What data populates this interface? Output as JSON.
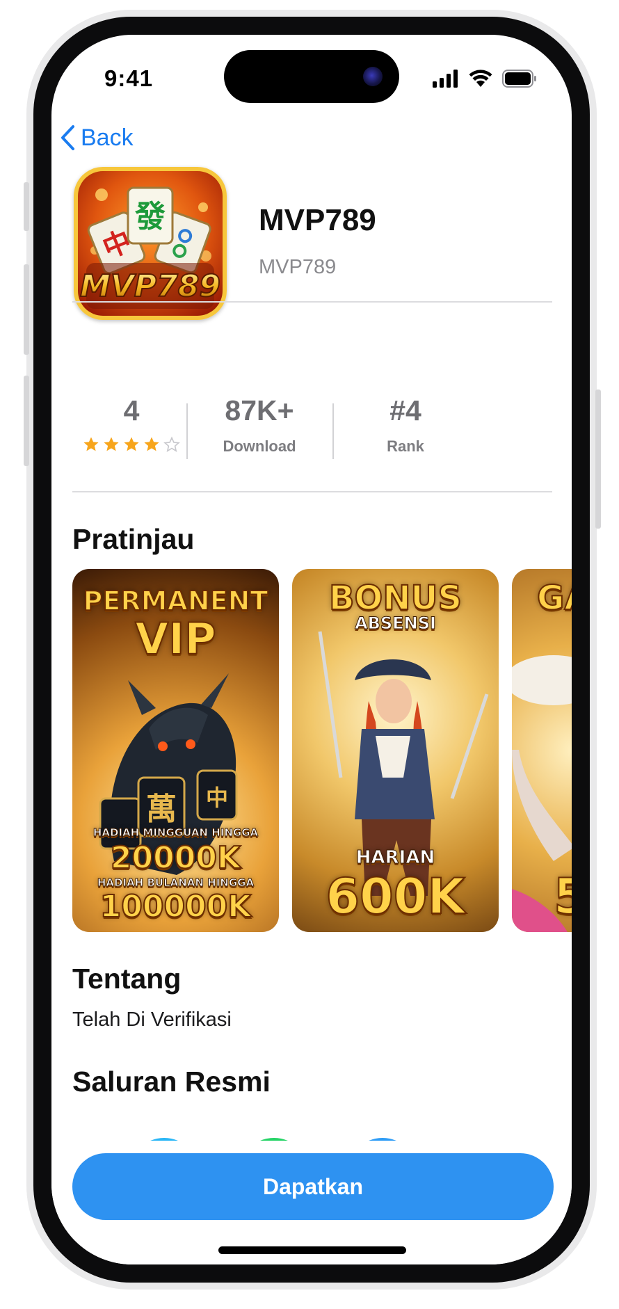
{
  "status_bar": {
    "time": "9:41"
  },
  "nav": {
    "back_label": "Back"
  },
  "app": {
    "name": "MVP789",
    "subtitle": "MVP789",
    "icon_text": "MVP789"
  },
  "stats": {
    "rating": {
      "value": "4",
      "stars": 4,
      "max_stars": 5
    },
    "downloads": {
      "value": "87K+",
      "label": "Download"
    },
    "rank": {
      "value": "#4",
      "label": "Rank"
    }
  },
  "preview": {
    "title": "Pratinjau",
    "screenshots": [
      {
        "title_1": "PERMANENT",
        "title_2": "VIP",
        "line_1": "HADIAH MINGGUAN HINGGA",
        "line_2": "20000K",
        "line_3": "HADIAH BULANAN HINGGA",
        "line_4": "100000K"
      },
      {
        "title_1": "BONUS",
        "title_2": "ABSENSI",
        "line_1": "HARIAN",
        "line_2": "600K"
      },
      {
        "title_1": "GA",
        "line_1": "5"
      }
    ]
  },
  "about": {
    "title": "Tentang",
    "text": "Telah Di Verifikasi"
  },
  "channels": {
    "title": "Saluran Resmi"
  },
  "cta": {
    "label": "Dapatkan"
  },
  "colors": {
    "accent": "#2e92f1",
    "back_link": "#1a7cf0",
    "star": "#f7a51c",
    "star_empty": "#c7c7cc"
  }
}
